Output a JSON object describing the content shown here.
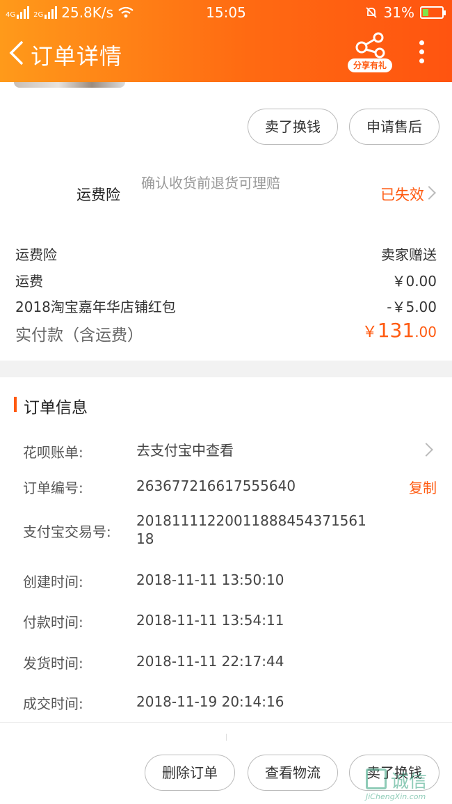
{
  "status_bar": {
    "signal1": "4G",
    "signal2": "2G",
    "speed": "25.8K/s",
    "time": "15:05",
    "battery": "31%",
    "battery_level": 0.31
  },
  "header": {
    "title": "订单详情",
    "share_badge": "分享有礼"
  },
  "top_actions": {
    "sell": "卖了换钱",
    "after_sale": "申请售后"
  },
  "shipping_insurance": {
    "label": "运费险",
    "desc": "确认收货前退货可理赔",
    "status": "已失效"
  },
  "costs": [
    {
      "label": "运费险",
      "value": "卖家赠送"
    },
    {
      "label": "运费",
      "value": "￥0.00"
    },
    {
      "label": "2018淘宝嘉年华店铺红包",
      "value": "-￥5.00"
    }
  ],
  "paid": {
    "label": "实付款（含运费）",
    "currency": "￥",
    "integer": "131",
    "decimal": ".00"
  },
  "order_info": {
    "title": "订单信息",
    "huabei_label": "花呗账单:",
    "huabei_value": "去支付宝中查看",
    "order_no_label": "订单编号:",
    "order_no": "263677216617555640",
    "copy": "复制",
    "alipay_label": "支付宝交易号:",
    "alipay_no": "20181111220011888454371561 18",
    "created_label": "创建时间:",
    "created": "2018-11-11 13:50:10",
    "paid_label": "付款时间:",
    "paid_time": "2018-11-11 13:54:11",
    "shipped_label": "发货时间:",
    "shipped": "2018-11-11 22:17:44",
    "closed_label": "成交时间:",
    "closed": "2018-11-19 20:14:16"
  },
  "bottom_actions": {
    "delete": "删除订单",
    "logistics": "查看物流",
    "sell": "卖了换钱"
  },
  "watermark": {
    "text": "诚信",
    "site": "JiChengXin.com"
  }
}
